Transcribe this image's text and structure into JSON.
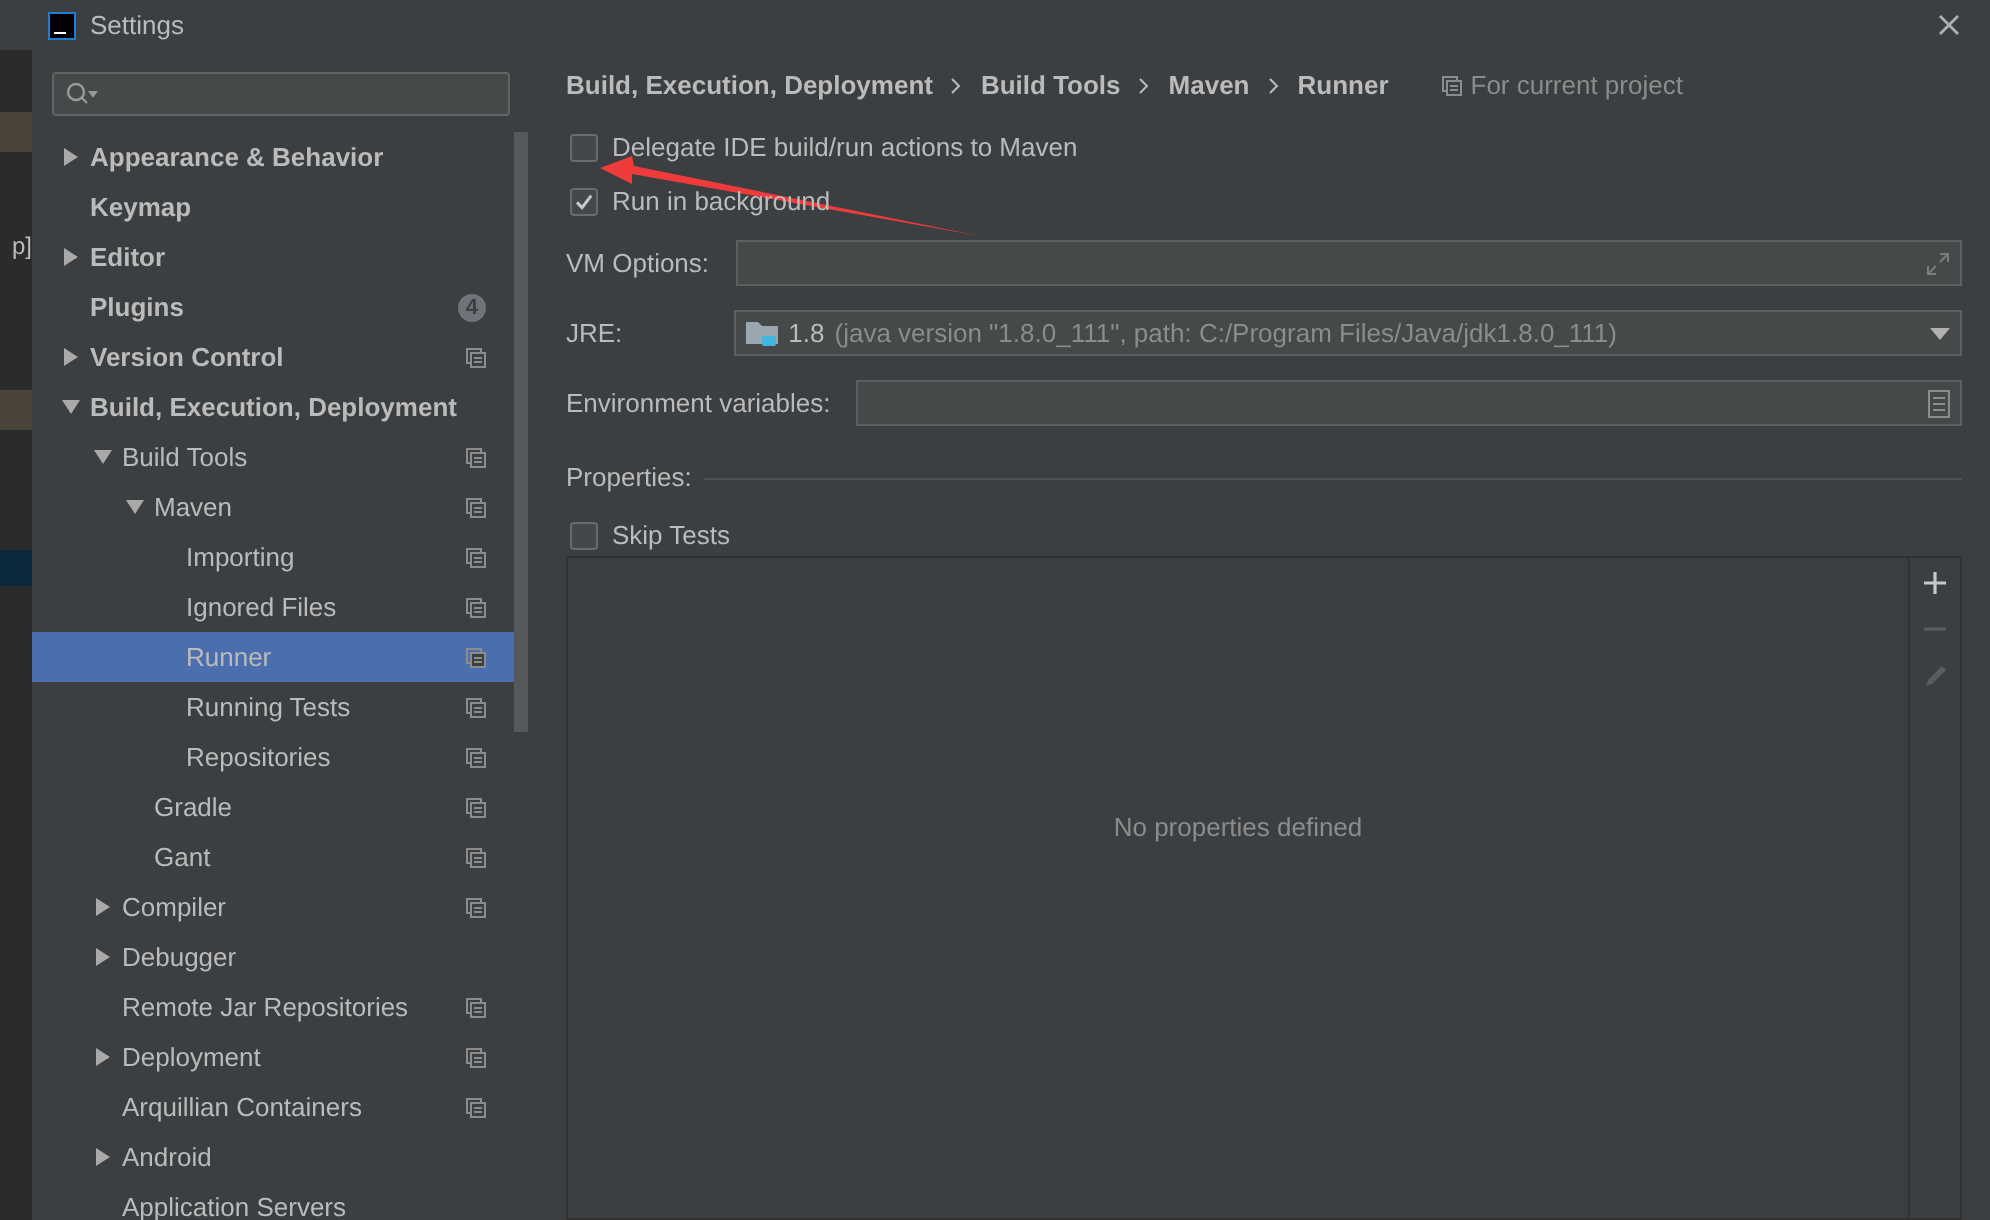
{
  "backdrop": {
    "fragment": "p]"
  },
  "window": {
    "title": "Settings"
  },
  "tree": [
    {
      "label": "Appearance & Behavior",
      "expanded": false,
      "selected": false,
      "project_icon": false
    },
    {
      "label": "Keymap",
      "selected": false,
      "project_icon": false
    },
    {
      "label": "Editor",
      "expanded": false,
      "selected": false,
      "project_icon": false
    },
    {
      "label": "Plugins",
      "selected": false,
      "project_icon": false,
      "badge": "4"
    },
    {
      "label": "Version Control",
      "expanded": false,
      "selected": false,
      "project_icon": true
    },
    {
      "label": "Build, Execution, Deployment",
      "expanded": true,
      "selected": false,
      "project_icon": false,
      "children": [
        {
          "label": "Build Tools",
          "expanded": true,
          "selected": false,
          "project_icon": true,
          "children": [
            {
              "label": "Maven",
              "expanded": true,
              "selected": false,
              "project_icon": true,
              "children": [
                {
                  "label": "Importing",
                  "selected": false,
                  "project_icon": true
                },
                {
                  "label": "Ignored Files",
                  "selected": false,
                  "project_icon": true
                },
                {
                  "label": "Runner",
                  "selected": true,
                  "project_icon": true
                },
                {
                  "label": "Running Tests",
                  "selected": false,
                  "project_icon": true
                },
                {
                  "label": "Repositories",
                  "selected": false,
                  "project_icon": true
                }
              ]
            },
            {
              "label": "Gradle",
              "selected": false,
              "project_icon": true
            },
            {
              "label": "Gant",
              "selected": false,
              "project_icon": true
            }
          ]
        },
        {
          "label": "Compiler",
          "expanded": false,
          "selected": false,
          "project_icon": true
        },
        {
          "label": "Debugger",
          "expanded": false,
          "selected": false,
          "project_icon": false
        },
        {
          "label": "Remote Jar Repositories",
          "selected": false,
          "project_icon": true
        },
        {
          "label": "Deployment",
          "expanded": false,
          "selected": false,
          "project_icon": true
        },
        {
          "label": "Arquillian Containers",
          "selected": false,
          "project_icon": true
        },
        {
          "label": "Android",
          "expanded": false,
          "selected": false,
          "project_icon": false
        },
        {
          "label": "Application Servers",
          "selected": false,
          "project_icon": false
        }
      ]
    }
  ],
  "breadcrumb": [
    "Build, Execution, Deployment",
    "Build Tools",
    "Maven",
    "Runner"
  ],
  "scope_note": "For current project",
  "options": [
    {
      "label": "Delegate IDE build/run actions to Maven",
      "checked": false
    },
    {
      "label": "Run in background",
      "checked": true
    }
  ],
  "fields": [
    {
      "kind": "expand",
      "label": "VM Options:"
    },
    {
      "kind": "dropdown",
      "label": "JRE:",
      "value": "1.8",
      "detail": "(java version \"1.8.0_111\", path: C:/Program Files/Java/jdk1.8.0_111)"
    },
    {
      "kind": "edit",
      "label": "Environment variables:"
    }
  ],
  "properties": {
    "title": "Properties:",
    "skip_tests": {
      "label": "Skip Tests",
      "checked": false
    },
    "empty_text": "No properties defined"
  }
}
